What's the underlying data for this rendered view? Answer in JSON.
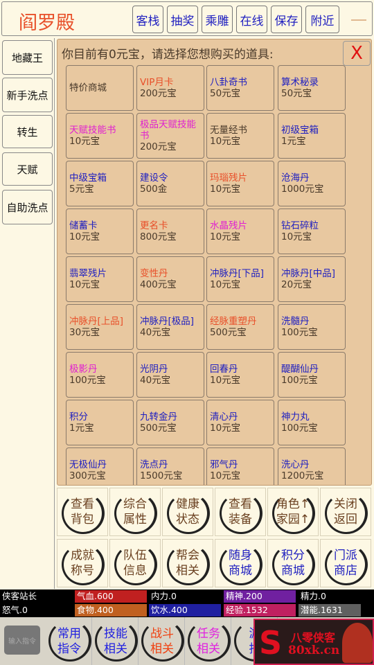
{
  "header": {
    "title": "阎罗殿",
    "buttons": [
      "客栈",
      "抽奖",
      "乘雕",
      "在线",
      "保存",
      "附近"
    ]
  },
  "sidebar": [
    "地藏王",
    "新手洗点",
    "转生",
    "天赋",
    "自助洗点"
  ],
  "shop": {
    "prompt": "你目前有0元宝，请选择您想购买的道具:",
    "close": "X",
    "items": [
      {
        "n": "特价商城",
        "p": "",
        "c": "#4a3a2a"
      },
      {
        "n": "VIP月卡",
        "p": "200元宝",
        "c": "#e8502a"
      },
      {
        "n": "八卦奇书",
        "p": "50元宝",
        "c": "#2020c0"
      },
      {
        "n": "算术秘录",
        "p": "50元宝",
        "c": "#2020c0"
      },
      {
        "n": "天赋技能书",
        "p": "10元宝",
        "c": "#e020d0"
      },
      {
        "n": "极品天赋技能书",
        "p": "200元宝",
        "c": "#e020d0"
      },
      {
        "n": "无量经书",
        "p": "10元宝",
        "c": "#4a3a2a"
      },
      {
        "n": "初级宝箱",
        "p": "1元宝",
        "c": "#2020c0"
      },
      {
        "n": "中级宝箱",
        "p": "5元宝",
        "c": "#2020c0"
      },
      {
        "n": "建设令",
        "p": "500金",
        "c": "#2020c0"
      },
      {
        "n": "玛瑙残片",
        "p": "10元宝",
        "c": "#e8502a"
      },
      {
        "n": "沧海丹",
        "p": "1000元宝",
        "c": "#2020c0"
      },
      {
        "n": "储蓄卡",
        "p": "10元宝",
        "c": "#2020c0"
      },
      {
        "n": "更名卡",
        "p": "800元宝",
        "c": "#e8502a"
      },
      {
        "n": "水晶残片",
        "p": "10元宝",
        "c": "#e020d0"
      },
      {
        "n": "钻石碎粒",
        "p": "10元宝",
        "c": "#2020c0"
      },
      {
        "n": "翡翠残片",
        "p": "10元宝",
        "c": "#2020c0"
      },
      {
        "n": "变性丹",
        "p": "400元宝",
        "c": "#e8502a"
      },
      {
        "n": "冲脉丹[下品]",
        "p": "10元宝",
        "c": "#2020c0"
      },
      {
        "n": "冲脉丹[中品]",
        "p": "20元宝",
        "c": "#2020c0"
      },
      {
        "n": "冲脉丹[上品]",
        "p": "30元宝",
        "c": "#e8502a"
      },
      {
        "n": "冲脉丹[极品]",
        "p": "40元宝",
        "c": "#2020c0"
      },
      {
        "n": "经脉重塑丹",
        "p": "500元宝",
        "c": "#e8502a"
      },
      {
        "n": "洗髓丹",
        "p": "100元宝",
        "c": "#2020c0"
      },
      {
        "n": "极影丹",
        "p": "100元宝",
        "c": "#e020d0"
      },
      {
        "n": "光阴丹",
        "p": "40元宝",
        "c": "#2020c0"
      },
      {
        "n": "回春丹",
        "p": "10元宝",
        "c": "#2020c0"
      },
      {
        "n": "醍醐仙丹",
        "p": "100元宝",
        "c": "#2020c0"
      },
      {
        "n": "积分",
        "p": "1元宝",
        "c": "#2020c0"
      },
      {
        "n": "九转金丹",
        "p": "500元宝",
        "c": "#2020c0"
      },
      {
        "n": "清心丹",
        "p": "10元宝",
        "c": "#2020c0"
      },
      {
        "n": "神力丸",
        "p": "100元宝",
        "c": "#2020c0"
      },
      {
        "n": "无极仙丹",
        "p": "300元宝",
        "c": "#2020c0"
      },
      {
        "n": "洗点丹",
        "p": "1500元宝",
        "c": "#2020c0"
      },
      {
        "n": "邪气丹",
        "p": "10元宝",
        "c": "#2020c0"
      },
      {
        "n": "洗心丹",
        "p": "1200元宝",
        "c": "#2020c0"
      }
    ]
  },
  "actions": [
    {
      "l1": "查看",
      "l2": "背包",
      "c": "#6a4020"
    },
    {
      "l1": "综合",
      "l2": "属性",
      "c": "#6a4020"
    },
    {
      "l1": "健康",
      "l2": "状态",
      "c": "#6a4020"
    },
    {
      "l1": "查看",
      "l2": "装备",
      "c": "#6a4020"
    },
    {
      "l1": "角色↑",
      "l2": "家园↑",
      "c": "#6a4020"
    },
    {
      "l1": "关闭",
      "l2": "返回",
      "c": "#6a4020"
    },
    {
      "l1": "成就",
      "l2": "称号",
      "c": "#6a4020"
    },
    {
      "l1": "队伍",
      "l2": "信息",
      "c": "#6a4020"
    },
    {
      "l1": "帮会",
      "l2": "相关",
      "c": "#6a4020"
    },
    {
      "l1": "随身",
      "l2": "商城",
      "c": "#2020c0"
    },
    {
      "l1": "积分",
      "l2": "商城",
      "c": "#2020c0"
    },
    {
      "l1": "门派",
      "l2": "商店",
      "c": "#2020c0"
    }
  ],
  "status": {
    "name": "侠客站长",
    "rage": "怒气.0",
    "bars": [
      {
        "t": "气血.600",
        "c": "#c02020",
        "fill": 1
      },
      {
        "t": "内力.0",
        "c": "#000000",
        "fill": 0
      },
      {
        "t": "精神.200",
        "c": "#7020a0",
        "fill": 1
      },
      {
        "t": "精力.0",
        "c": "#000000",
        "fill": 0
      },
      {
        "t": "食物.400",
        "c": "#c06020",
        "fill": 1
      },
      {
        "t": "饮水.400",
        "c": "#2020a0",
        "fill": 1
      },
      {
        "t": "经验.1532",
        "c": "#c02060",
        "fill": 1
      },
      {
        "t": "潜能.1631",
        "c": "#606060",
        "fill": 1
      }
    ]
  },
  "bottom": {
    "input": "输入指令",
    "tabs": [
      {
        "l1": "常用",
        "l2": "指令",
        "c": "#2020e0"
      },
      {
        "l1": "技能",
        "l2": "相关",
        "c": "#2020e0"
      },
      {
        "l1": "战斗",
        "l2": "相关",
        "c": "#f04010"
      },
      {
        "l1": "任务",
        "l2": "相关",
        "c": "#e020e0"
      },
      {
        "l1": "游",
        "l2": "指",
        "c": "#2020e0"
      }
    ]
  },
  "ad": {
    "name": "八零侠客",
    "url": "80xk.cn"
  }
}
